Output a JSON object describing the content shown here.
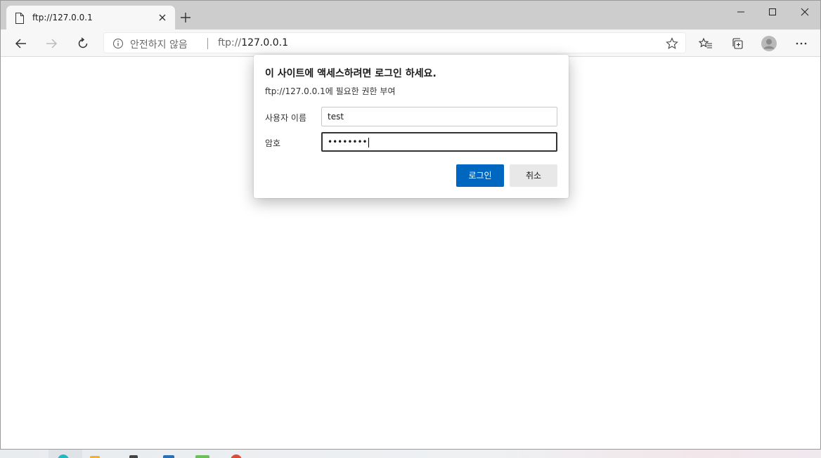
{
  "browser": {
    "tab": {
      "title": "ftp://127.0.0.1"
    },
    "address_bar": {
      "security_text": "안전하지 않음",
      "url_scheme": "ftp://",
      "url_host": "127.0.0.1"
    }
  },
  "dialog": {
    "title": "이 사이트에 액세스하려면 로그인 하세요.",
    "subtitle": "ftp://127.0.0.1에 필요한 권한 부여",
    "username_label": "사용자 이름",
    "username_value": "test",
    "password_label": "암호",
    "password_value": "••••••••",
    "login_button": "로그인",
    "cancel_button": "취소"
  },
  "colors": {
    "accent": "#0067c0",
    "tabstrip": "#cdcdcd",
    "toolbar": "#f7f7f7"
  },
  "icons": [
    "page-icon",
    "close-icon",
    "plus-icon",
    "minimize-icon",
    "maximize-icon",
    "back-icon",
    "forward-icon",
    "refresh-icon",
    "info-icon",
    "star-icon",
    "favorites-icon",
    "collections-icon",
    "profile-icon",
    "more-icon"
  ]
}
